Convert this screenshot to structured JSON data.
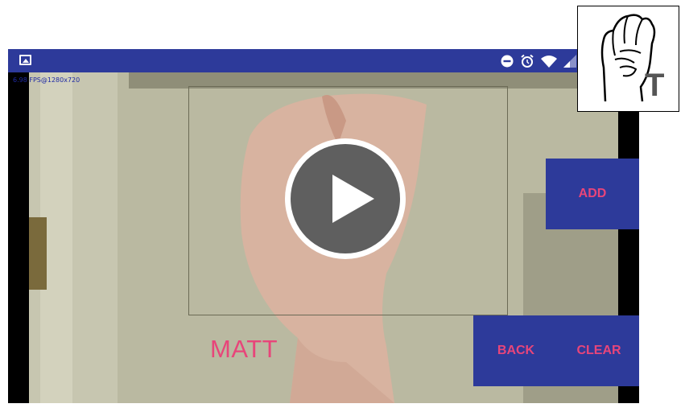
{
  "status_bar": {
    "left_icon": "image-icon",
    "icons": [
      "do-not-disturb-icon",
      "alarm-icon",
      "wifi-icon",
      "signal-icon"
    ],
    "color": "#2d3a9a"
  },
  "camera": {
    "fps_label": "6.98 FPS@1280x720"
  },
  "recognized": {
    "word": "MATT"
  },
  "buttons": {
    "add": "ADD",
    "back": "BACK",
    "clear": "CLEAR"
  },
  "sign_reference": {
    "letter": "T"
  },
  "colors": {
    "accent_text": "#e8457a",
    "button_bg": "#2d3a9a"
  }
}
